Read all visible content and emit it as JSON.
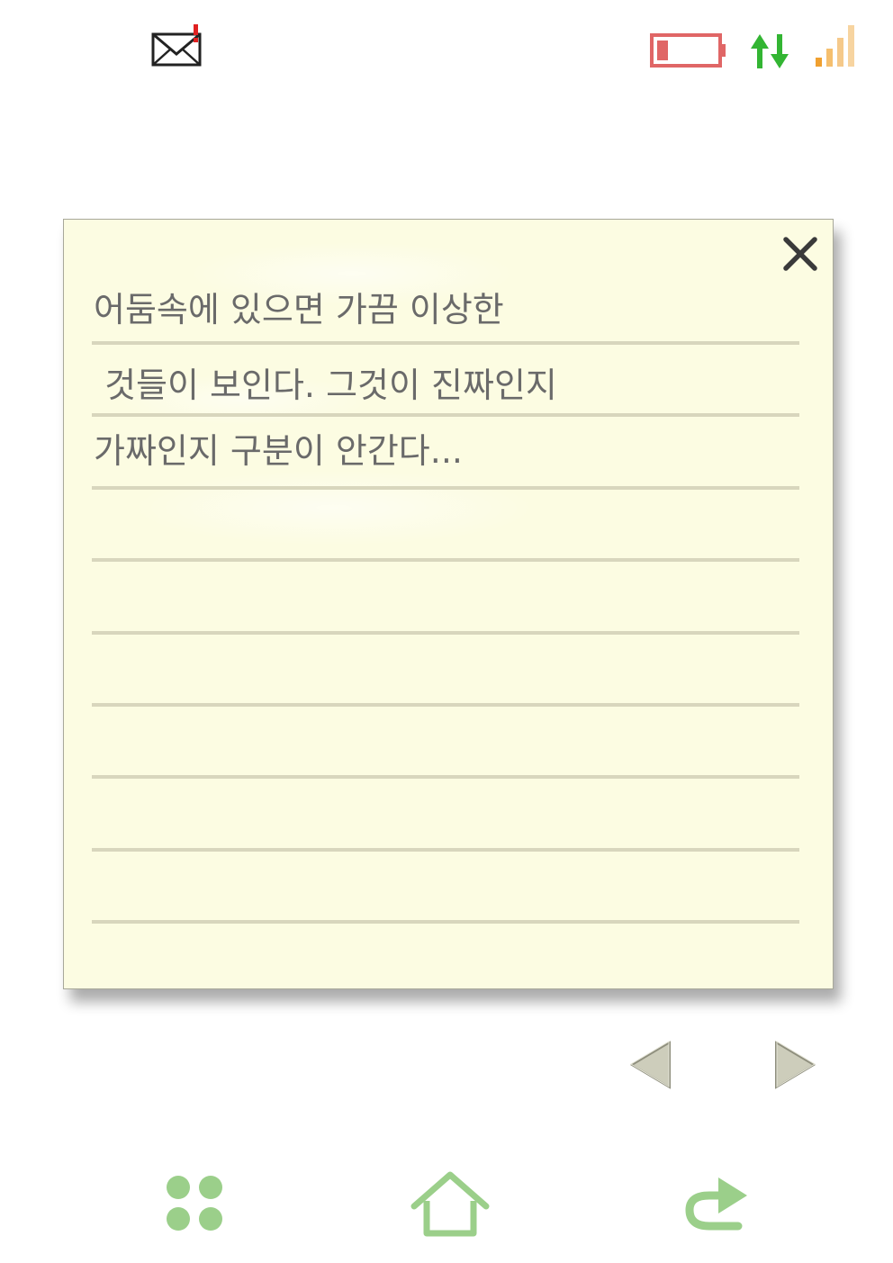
{
  "status_bar": {
    "icons": [
      "mail-notification-icon",
      "battery-low-icon",
      "data-transfer-icon",
      "signal-strength-icon"
    ],
    "colors": {
      "battery": "#e06666",
      "data_arrows": "#33b533",
      "signal": "#f0a030"
    }
  },
  "note": {
    "lines": [
      "어둠속에 있으면 가끔 이상한",
      " 것들이 보인다. 그것이 진짜인지",
      "가짜인지 구분이 안간다..."
    ],
    "close_icon": "close-x-icon",
    "background_color": "#fcfce2"
  },
  "pager": {
    "prev_icon": "triangle-left-icon",
    "next_icon": "triangle-right-icon"
  },
  "bottom_nav": {
    "icons": [
      "apps-grid-icon",
      "home-icon",
      "back-arrow-icon"
    ],
    "color": "#9bcf8a"
  }
}
